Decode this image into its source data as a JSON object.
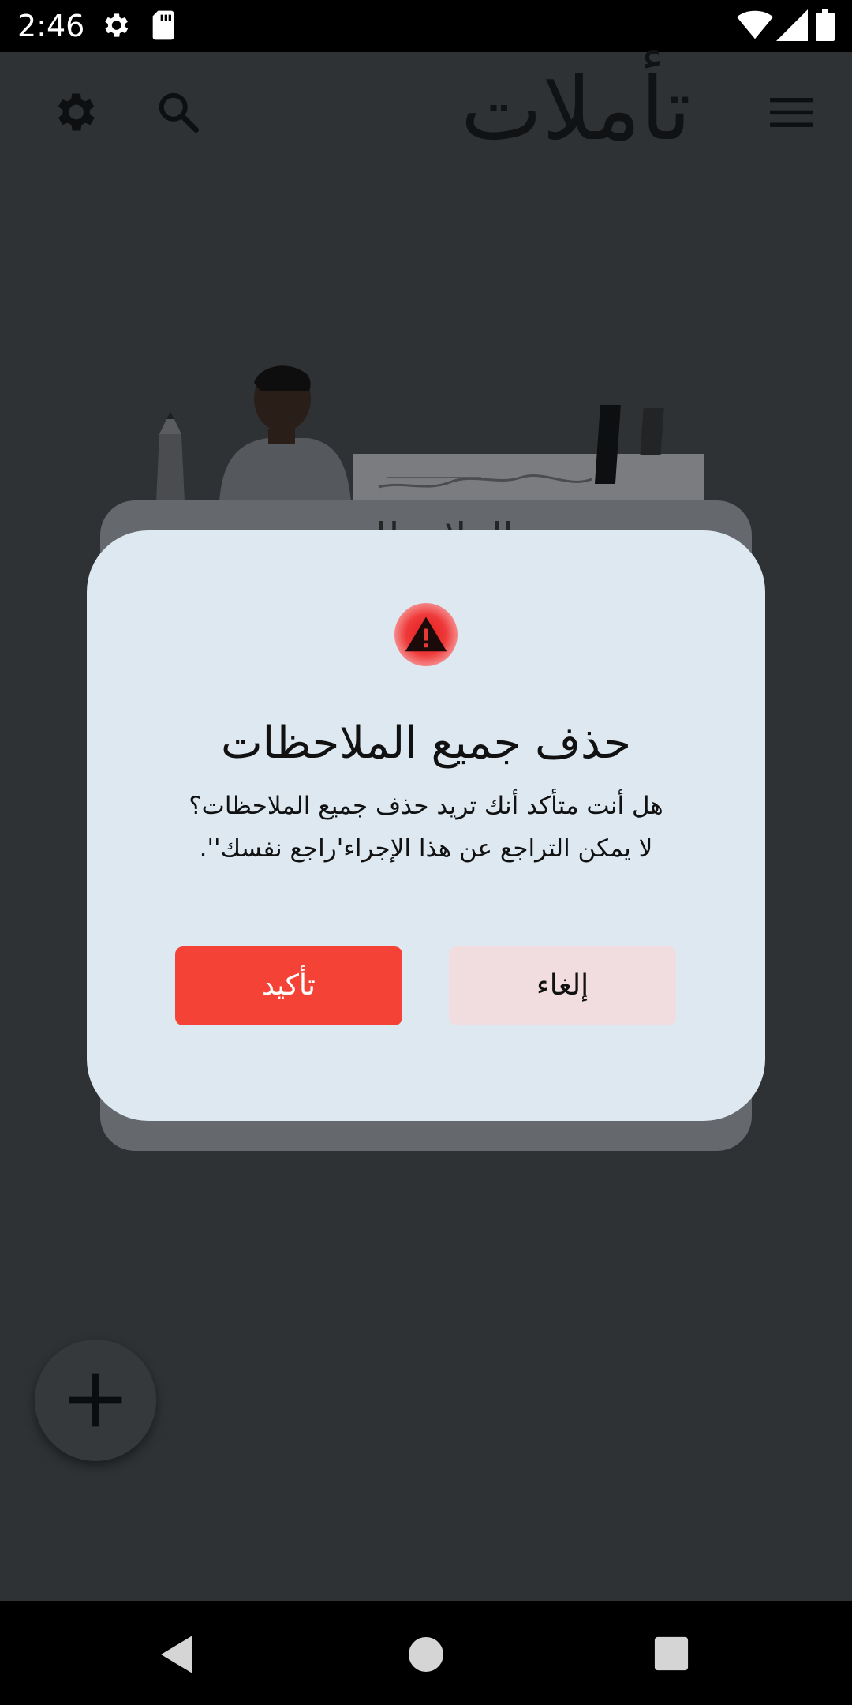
{
  "status_bar": {
    "time": "2:46",
    "icons": [
      "settings-icon",
      "sd-card-icon",
      "wifi-icon",
      "signal-icon",
      "battery-icon"
    ]
  },
  "app_bar": {
    "title": "تأملات",
    "icons": [
      "menu-icon",
      "search-icon",
      "settings-icon"
    ]
  },
  "background": {
    "card_title": "الملاحظات"
  },
  "dialog": {
    "icon": "warning-icon",
    "title": "حذف جميع الملاحظات",
    "message_line1": "هل أنت متأكد أنك تريد حذف جميع الملاحظات؟",
    "message_line2": "لا يمكن التراجع عن هذا الإجراء'راجع نفسك''.",
    "confirm_label": "تأكيد",
    "cancel_label": "إلغاء",
    "confirm_color": "#f44336",
    "cancel_color": "#f1dcdf"
  },
  "fab": {
    "icon": "add-icon"
  },
  "nav_bar": {
    "icons": [
      "back-icon",
      "home-icon",
      "recents-icon"
    ]
  }
}
